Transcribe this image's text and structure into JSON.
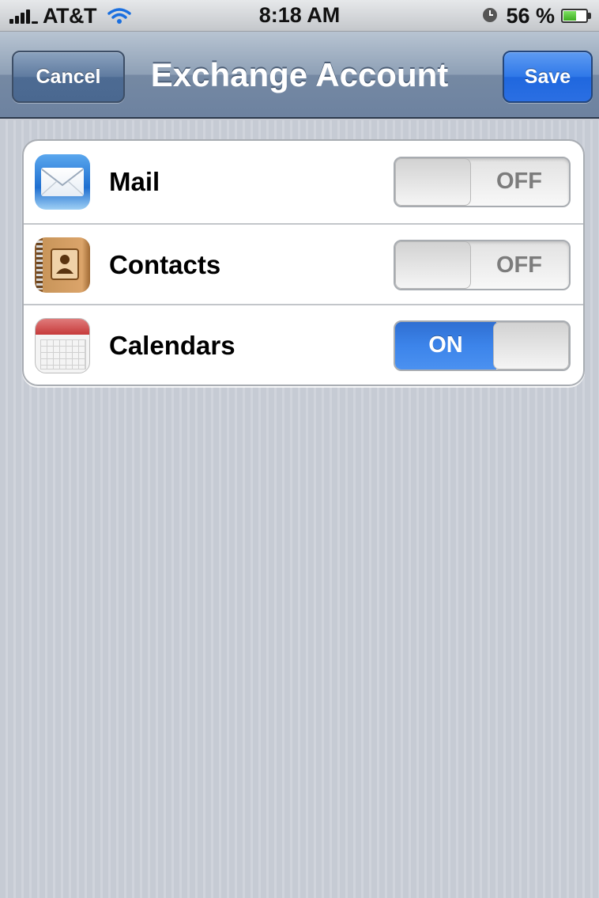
{
  "status_bar": {
    "carrier": "AT&T",
    "time": "8:18 AM",
    "battery_percent": "56 %",
    "battery_level": 0.56,
    "icons": [
      "signal-bars-icon",
      "wifi-icon",
      "clock-icon",
      "battery-icon"
    ]
  },
  "nav": {
    "title": "Exchange Account",
    "cancel_label": "Cancel",
    "save_label": "Save"
  },
  "rows": [
    {
      "label": "Mail",
      "icon": "mail-icon",
      "toggle": "OFF"
    },
    {
      "label": "Contacts",
      "icon": "contacts-icon",
      "toggle": "OFF"
    },
    {
      "label": "Calendars",
      "icon": "calendar-icon",
      "toggle": "ON"
    }
  ],
  "colors": {
    "nav_bar": "#7a8ea8",
    "save_button": "#2b6fe3",
    "toggle_on": "#3c84ea"
  }
}
